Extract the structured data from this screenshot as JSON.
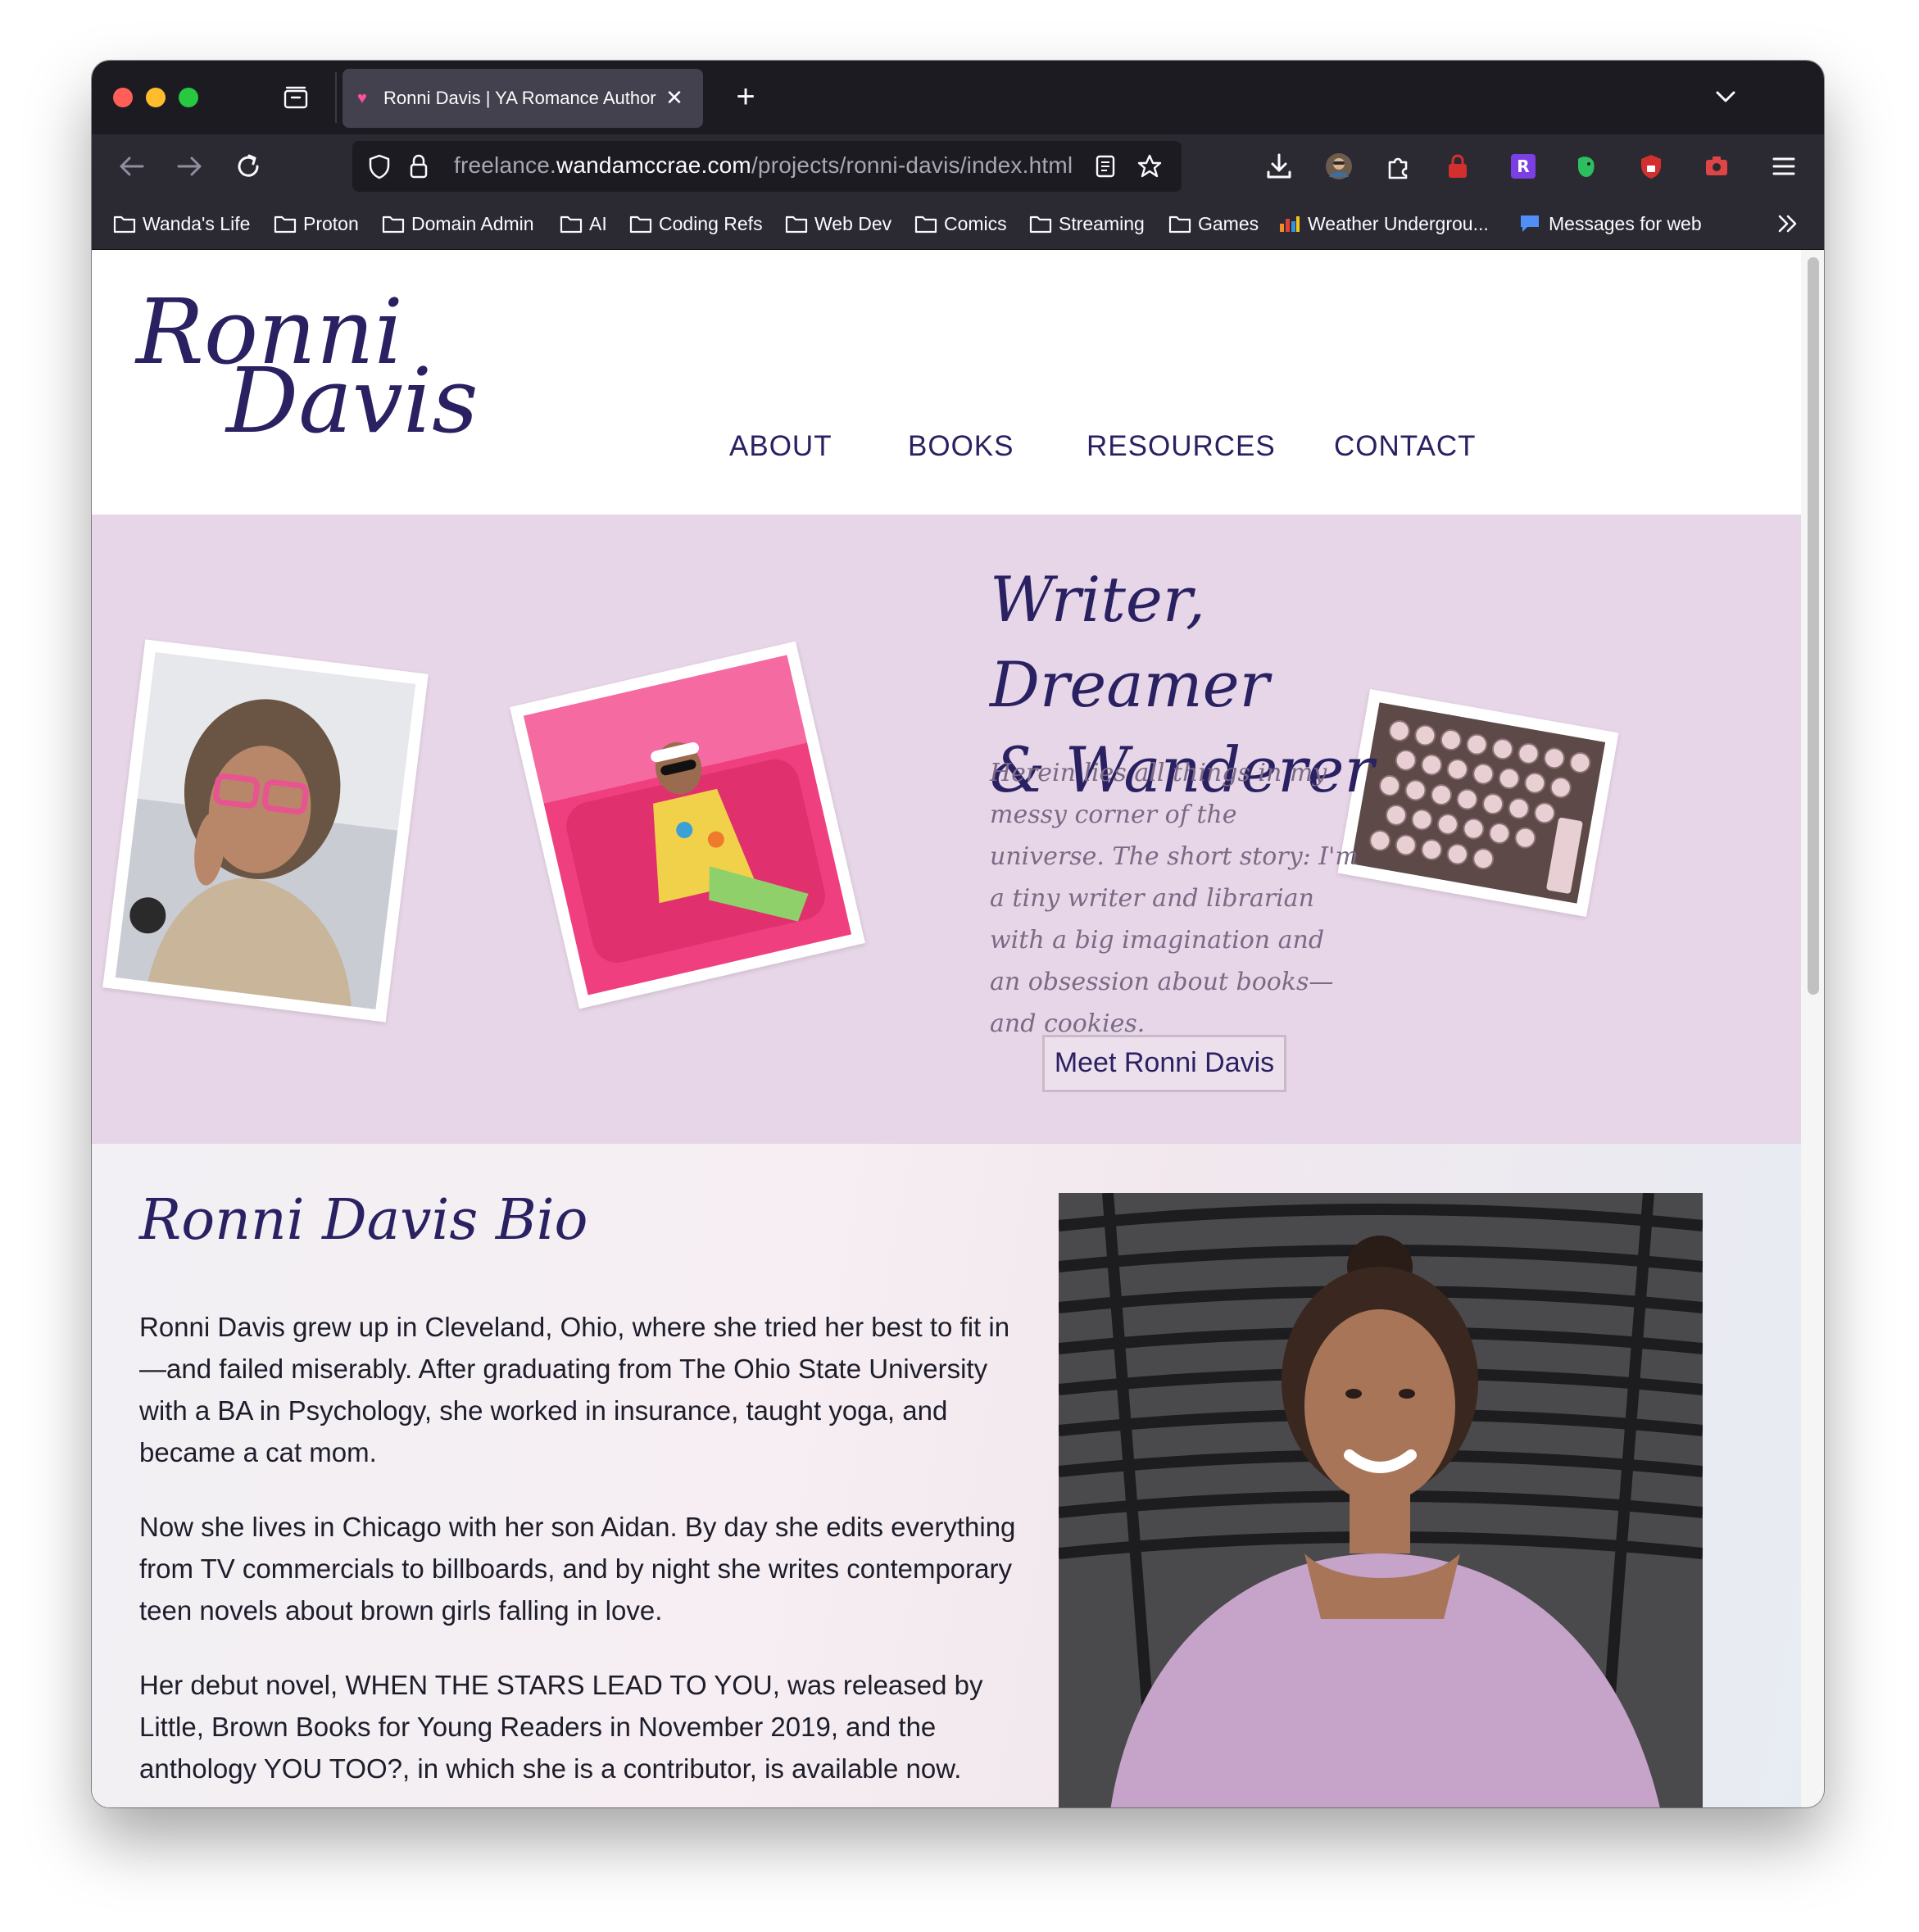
{
  "browser": {
    "tab": {
      "title": "Ronni Davis | YA Romance Author",
      "favicon": "heart-icon",
      "close_icon": "close-icon"
    },
    "new_tab_label": "+",
    "url": {
      "prefix": "freelance.",
      "domain": "wandamccrae.com",
      "path": "/projects/ronni-davis/index.html"
    },
    "bookmarks": [
      {
        "label": "Wanda's Life",
        "icon": "folder-icon"
      },
      {
        "label": "Proton",
        "icon": "folder-icon"
      },
      {
        "label": "Domain Admin",
        "icon": "folder-icon"
      },
      {
        "label": "AI",
        "icon": "folder-icon"
      },
      {
        "label": "Coding Refs",
        "icon": "folder-icon"
      },
      {
        "label": "Web Dev",
        "icon": "folder-icon"
      },
      {
        "label": "Comics",
        "icon": "folder-icon"
      },
      {
        "label": "Streaming",
        "icon": "folder-icon"
      },
      {
        "label": "Games",
        "icon": "folder-icon"
      },
      {
        "label": "Weather Undergrou...",
        "icon": "weather-underground-icon"
      },
      {
        "label": "Messages for web",
        "icon": "messages-icon"
      }
    ]
  },
  "site": {
    "logo": {
      "line1": "Ronni",
      "line2": "Davis"
    },
    "nav": [
      "ABOUT",
      "BOOKS",
      "RESOURCES",
      "CONTACT"
    ],
    "hero": {
      "title_line1": "Writer, Dreamer",
      "title_line2": "& Wanderer",
      "text": "Herein lies all things in my messy corner of the universe. The short story: I'm a tiny writer and librarian with a big imagination and an obsession about books—and cookies.",
      "button": "Meet Ronni Davis"
    },
    "bio": {
      "title": "Ronni Davis Bio",
      "paragraphs": [
        "Ronni Davis grew up in Cleveland, Ohio, where she tried her best to fit in—and failed miserably. After graduating from The Ohio State University with a BA in Psychology, she worked in insurance, taught yoga, and became a cat mom.",
        "Now she lives in Chicago with her son Aidan. By day she edits everything from TV commercials to billboards, and by night she writes contemporary teen novels about brown girls falling in love.",
        "Her debut novel, WHEN THE STARS LEAD TO YOU, was released by Little, Brown Books for Young Readers in November 2019, and the anthology YOU TOO?, in which she is a contributor, is available now."
      ]
    }
  },
  "colors": {
    "brand_purple": "#2a2162",
    "hero_bg": "#e7d6e7",
    "browser_dark": "#1c1b22",
    "toolbar": "#2b2a33"
  }
}
